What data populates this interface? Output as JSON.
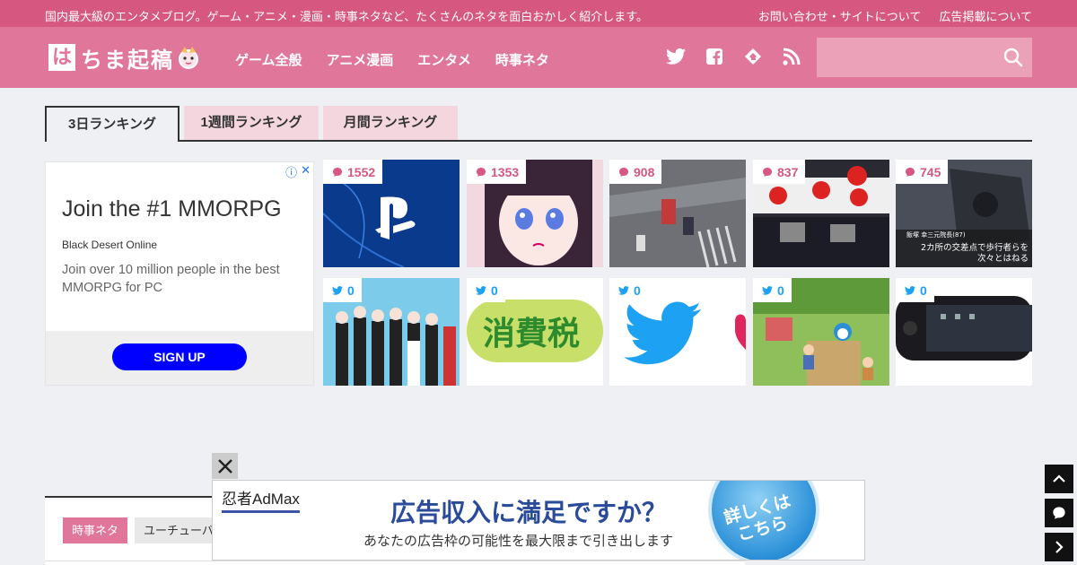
{
  "topbar": {
    "tagline": "国内最大級のエンタメブログ。ゲーム・アニメ・漫画・時事ネタなど、たくさんのネタを面白おかしく紹介します。",
    "links": [
      "お問い合わせ・サイトについて",
      "広告掲載について"
    ]
  },
  "header": {
    "logo_first": "は",
    "logo_rest": "ちま起稿",
    "nav": [
      "ゲーム全般",
      "アニメ漫画",
      "エンタメ",
      "時事ネタ"
    ],
    "social_icons": [
      "twitter-icon",
      "facebook-icon",
      "feedly-icon",
      "rss-icon"
    ],
    "search_placeholder": ""
  },
  "tabs": [
    "3日ランキング",
    "1週間ランキング",
    "月間ランキング"
  ],
  "ad": {
    "title": "Join the #1 MMORPG",
    "brand": "Black Desert Online",
    "description": "Join over 10 million people in the best MMORPG for PC",
    "cta": "SIGN UP"
  },
  "ranking": {
    "top_row": [
      {
        "count": "1552",
        "icon": "comment-icon"
      },
      {
        "count": "1353",
        "icon": "comment-icon"
      },
      {
        "count": "908",
        "icon": "comment-icon"
      },
      {
        "count": "837",
        "icon": "comment-icon"
      },
      {
        "count": "745",
        "icon": "comment-icon"
      }
    ],
    "bottom_row": [
      {
        "count": "0",
        "icon": "twitter-icon"
      },
      {
        "count": "0",
        "icon": "twitter-icon",
        "thumb_text": "消費税"
      },
      {
        "count": "0",
        "icon": "twitter-icon"
      },
      {
        "count": "0",
        "icon": "twitter-icon"
      },
      {
        "count": "0",
        "icon": "twitter-icon"
      }
    ],
    "thumb5_caption_1": "2カ所の交差点で歩行者らを",
    "thumb5_caption_2": "次々とはねる",
    "thumb5_tag": "飯塚 幸三元院長(87)"
  },
  "admax": {
    "brand": "忍者AdMax",
    "headline": "広告収入に満足ですか？",
    "sub": "あなたの広告枠の可能性を最大限まで引き出します",
    "circle_text_1": "詳しくは",
    "circle_text_2": "こちら"
  },
  "article": {
    "category": "時事ネタ",
    "tag": "ユーチューバ"
  },
  "colors": {
    "brand": "#e0769a",
    "topbar": "#d6577f",
    "accent_blue": "#1da1f2"
  }
}
